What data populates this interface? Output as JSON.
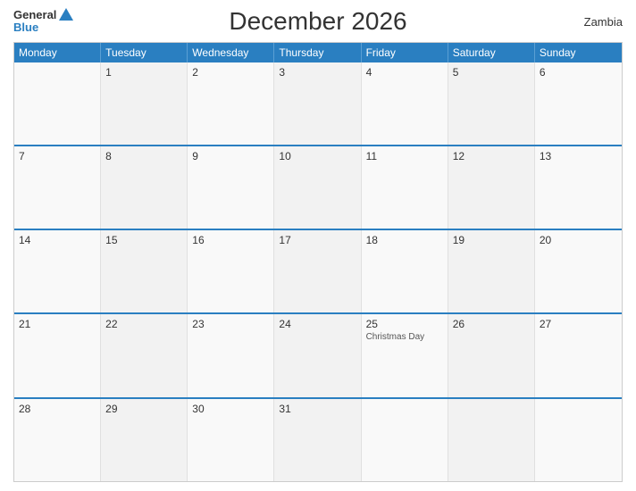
{
  "header": {
    "title": "December 2026",
    "country": "Zambia",
    "logo_general": "General",
    "logo_blue": "Blue"
  },
  "days": {
    "headers": [
      "Monday",
      "Tuesday",
      "Wednesday",
      "Thursday",
      "Friday",
      "Saturday",
      "Sunday"
    ]
  },
  "weeks": [
    {
      "cells": [
        {
          "num": "",
          "empty": true
        },
        {
          "num": "1",
          "empty": false
        },
        {
          "num": "2",
          "empty": false
        },
        {
          "num": "3",
          "empty": false
        },
        {
          "num": "4",
          "empty": false
        },
        {
          "num": "5",
          "empty": false
        },
        {
          "num": "6",
          "empty": false
        }
      ]
    },
    {
      "cells": [
        {
          "num": "7",
          "empty": false
        },
        {
          "num": "8",
          "empty": false
        },
        {
          "num": "9",
          "empty": false
        },
        {
          "num": "10",
          "empty": false
        },
        {
          "num": "11",
          "empty": false
        },
        {
          "num": "12",
          "empty": false
        },
        {
          "num": "13",
          "empty": false
        }
      ]
    },
    {
      "cells": [
        {
          "num": "14",
          "empty": false
        },
        {
          "num": "15",
          "empty": false
        },
        {
          "num": "16",
          "empty": false
        },
        {
          "num": "17",
          "empty": false
        },
        {
          "num": "18",
          "empty": false
        },
        {
          "num": "19",
          "empty": false
        },
        {
          "num": "20",
          "empty": false
        }
      ]
    },
    {
      "cells": [
        {
          "num": "21",
          "empty": false
        },
        {
          "num": "22",
          "empty": false
        },
        {
          "num": "23",
          "empty": false
        },
        {
          "num": "24",
          "empty": false
        },
        {
          "num": "25",
          "empty": false,
          "event": "Christmas Day"
        },
        {
          "num": "26",
          "empty": false
        },
        {
          "num": "27",
          "empty": false
        }
      ]
    },
    {
      "cells": [
        {
          "num": "28",
          "empty": false
        },
        {
          "num": "29",
          "empty": false
        },
        {
          "num": "30",
          "empty": false
        },
        {
          "num": "31",
          "empty": false
        },
        {
          "num": "",
          "empty": true
        },
        {
          "num": "",
          "empty": true
        },
        {
          "num": "",
          "empty": true
        }
      ]
    }
  ]
}
